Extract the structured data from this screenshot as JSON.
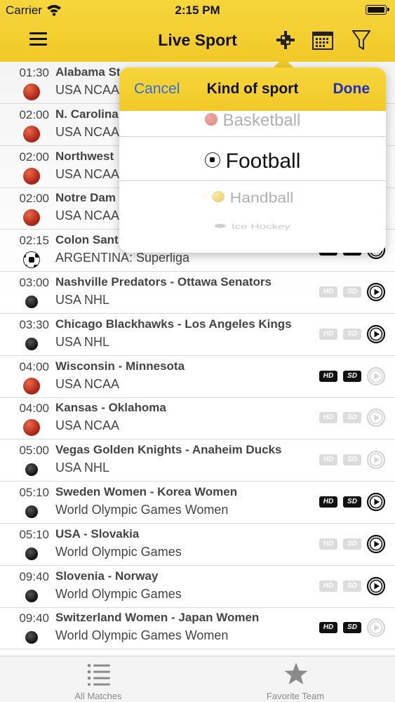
{
  "status_bar": {
    "carrier": "Carrier",
    "time": "2:15 PM"
  },
  "nav": {
    "title": "Live Sport"
  },
  "popover": {
    "cancel": "Cancel",
    "title": "Kind of sport",
    "done": "Done",
    "options": [
      "Basketball",
      "Football",
      "Handball",
      "Ice Hockey"
    ],
    "selected": "Football"
  },
  "matches": [
    {
      "time": "01:30",
      "title": "Alabama St",
      "league": "USA NCAA",
      "sport": "basketball",
      "hd": "",
      "sd": "",
      "play": ""
    },
    {
      "time": "02:00",
      "title": "N. Carolina",
      "league": "USA NCAA",
      "sport": "basketball",
      "hd": "",
      "sd": "",
      "play": ""
    },
    {
      "time": "02:00",
      "title": "Northwest",
      "league": "USA NCAA",
      "sport": "basketball",
      "hd": "",
      "sd": "",
      "play": ""
    },
    {
      "time": "02:00",
      "title": "Notre Dam",
      "league": "USA NCAA",
      "sport": "basketball",
      "hd": "",
      "sd": "",
      "play": ""
    },
    {
      "time": "02:15",
      "title": "Colon Sant",
      "league": "ARGENTINA: Superliga",
      "sport": "football",
      "hd": "on",
      "sd": "on",
      "play": "on"
    },
    {
      "time": "03:00",
      "title": "Nashville Predators - Ottawa Senators",
      "league": "USA NHL",
      "sport": "hockey",
      "hd": "off",
      "sd": "off",
      "play": "on"
    },
    {
      "time": "03:30",
      "title": "Chicago Blackhawks - Los Angeles Kings",
      "league": "USA NHL",
      "sport": "hockey",
      "hd": "off",
      "sd": "off",
      "play": "on"
    },
    {
      "time": "04:00",
      "title": "Wisconsin - Minnesota",
      "league": "USA NCAA",
      "sport": "basketball",
      "hd": "on",
      "sd": "on",
      "play": "off"
    },
    {
      "time": "04:00",
      "title": "Kansas - Oklahoma",
      "league": "USA NCAA",
      "sport": "basketball",
      "hd": "off",
      "sd": "off",
      "play": "off"
    },
    {
      "time": "05:00",
      "title": "Vegas Golden Knights - Anaheim Ducks",
      "league": "USA NHL",
      "sport": "hockey",
      "hd": "off",
      "sd": "off",
      "play": "off"
    },
    {
      "time": "05:10",
      "title": "Sweden Women - Korea Women",
      "league": "World Olympic Games Women",
      "sport": "hockey",
      "hd": "on",
      "sd": "on",
      "play": "on"
    },
    {
      "time": "05:10",
      "title": "USA - Slovakia",
      "league": "World Olympic Games",
      "sport": "hockey",
      "hd": "off",
      "sd": "off",
      "play": "on"
    },
    {
      "time": "09:40",
      "title": "Slovenia - Norway",
      "league": "World Olympic Games",
      "sport": "hockey",
      "hd": "off",
      "sd": "off",
      "play": "on"
    },
    {
      "time": "09:40",
      "title": "Switzerland Women - Japan Women",
      "league": "World Olympic Games Women",
      "sport": "hockey",
      "hd": "on",
      "sd": "on",
      "play": "off"
    }
  ],
  "badges": {
    "hd": "HD",
    "sd": "SD"
  },
  "tabs": {
    "all": "All Matches",
    "favorite": "Favorite Team"
  },
  "colors": {
    "accent": "#f1c928",
    "cancel": "#2f6ed8",
    "done": "#1f2fbf"
  }
}
